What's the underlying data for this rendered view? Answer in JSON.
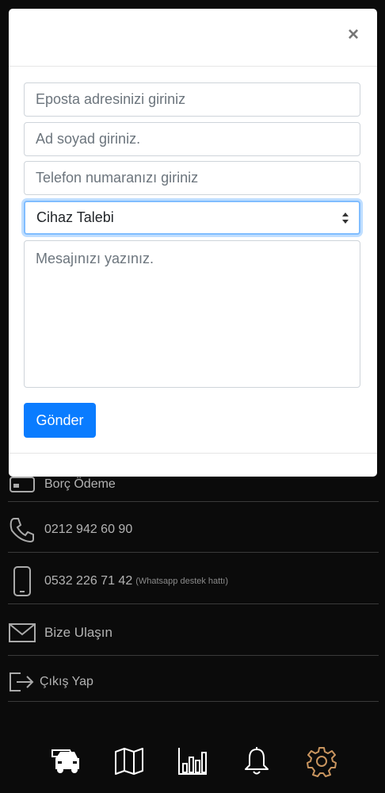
{
  "menu": {
    "items": [
      {
        "label": "Borç Ödeme",
        "icon": "card-icon"
      },
      {
        "label": "0212 942 60 90",
        "icon": "phone-icon"
      },
      {
        "label": "0532 226 71 42",
        "note": "(Whatsapp destek hattı)",
        "icon": "mobile-icon"
      },
      {
        "label": "Bize Ulaşın",
        "icon": "mail-icon"
      },
      {
        "label": "Çıkış Yap",
        "icon": "logout-icon"
      }
    ]
  },
  "tabbar": {
    "tabs": [
      {
        "name": "car-icon"
      },
      {
        "name": "map-icon"
      },
      {
        "name": "chart-icon"
      },
      {
        "name": "bell-icon"
      },
      {
        "name": "gear-icon",
        "active": true
      }
    ],
    "active_color": "#c9955f"
  },
  "modal": {
    "close_label": "×",
    "form": {
      "email_placeholder": "Eposta adresinizi giriniz",
      "name_placeholder": "Ad soyad giriniz.",
      "phone_placeholder": "Telefon numaranızı giriniz",
      "subject_value": "Cihaz Talebi",
      "message_placeholder": "Mesajınızı yazınız.",
      "submit_label": "Gönder"
    }
  },
  "colors": {
    "primary": "#0a7cff",
    "focus_border": "#80bdff"
  }
}
